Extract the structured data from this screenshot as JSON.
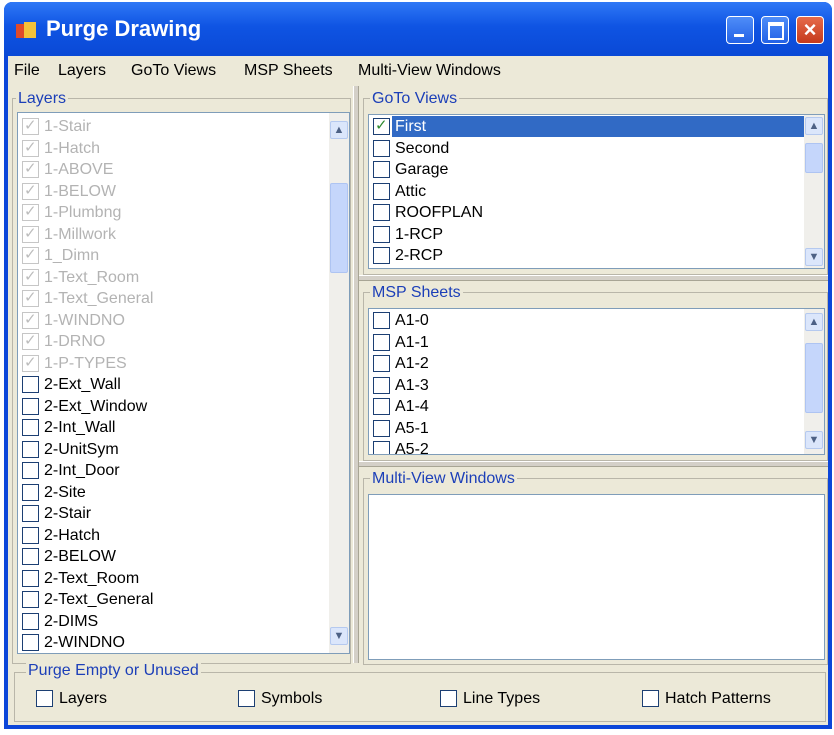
{
  "window": {
    "title": "Purge Drawing"
  },
  "menu": [
    "File",
    "Layers",
    "GoTo Views",
    "MSP Sheets",
    "Multi-View Windows"
  ],
  "layers": {
    "label": "Layers",
    "items": [
      {
        "label": "1-Stair",
        "checked": true,
        "disabled": true
      },
      {
        "label": "1-Hatch",
        "checked": true,
        "disabled": true
      },
      {
        "label": "1-ABOVE",
        "checked": true,
        "disabled": true
      },
      {
        "label": "1-BELOW",
        "checked": true,
        "disabled": true
      },
      {
        "label": "1-Plumbng",
        "checked": true,
        "disabled": true
      },
      {
        "label": "1-Millwork",
        "checked": true,
        "disabled": true
      },
      {
        "label": "1_Dimn",
        "checked": true,
        "disabled": true
      },
      {
        "label": "1-Text_Room",
        "checked": true,
        "disabled": true
      },
      {
        "label": "1-Text_General",
        "checked": true,
        "disabled": true
      },
      {
        "label": "1-WINDNO",
        "checked": true,
        "disabled": true
      },
      {
        "label": "1-DRNO",
        "checked": true,
        "disabled": true
      },
      {
        "label": "1-P-TYPES",
        "checked": true,
        "disabled": true
      },
      {
        "label": "2-Ext_Wall",
        "checked": false,
        "disabled": false
      },
      {
        "label": "2-Ext_Window",
        "checked": false,
        "disabled": false
      },
      {
        "label": "2-Int_Wall",
        "checked": false,
        "disabled": false
      },
      {
        "label": "2-UnitSym",
        "checked": false,
        "disabled": false
      },
      {
        "label": "2-Int_Door",
        "checked": false,
        "disabled": false
      },
      {
        "label": "2-Site",
        "checked": false,
        "disabled": false
      },
      {
        "label": "2-Stair",
        "checked": false,
        "disabled": false
      },
      {
        "label": "2-Hatch",
        "checked": false,
        "disabled": false
      },
      {
        "label": "2-BELOW",
        "checked": false,
        "disabled": false
      },
      {
        "label": "2-Text_Room",
        "checked": false,
        "disabled": false
      },
      {
        "label": "2-Text_General",
        "checked": false,
        "disabled": false
      },
      {
        "label": "2-DIMS",
        "checked": false,
        "disabled": false
      },
      {
        "label": "2-WINDNO",
        "checked": false,
        "disabled": false
      }
    ]
  },
  "goto_views": {
    "label": "GoTo Views",
    "items": [
      {
        "label": "First",
        "checked": true,
        "selected": true
      },
      {
        "label": "Second",
        "checked": false
      },
      {
        "label": "Garage",
        "checked": false
      },
      {
        "label": "Attic",
        "checked": false
      },
      {
        "label": "ROOFPLAN",
        "checked": false
      },
      {
        "label": "1-RCP",
        "checked": false
      },
      {
        "label": "2-RCP",
        "checked": false
      }
    ]
  },
  "msp_sheets": {
    "label": "MSP Sheets",
    "items": [
      {
        "label": "A1-0",
        "checked": false
      },
      {
        "label": "A1-1",
        "checked": false
      },
      {
        "label": "A1-2",
        "checked": false
      },
      {
        "label": "A1-3",
        "checked": false
      },
      {
        "label": "A1-4",
        "checked": false
      },
      {
        "label": "A5-1",
        "checked": false
      },
      {
        "label": "A5-2",
        "checked": false
      }
    ]
  },
  "multi_view_windows": {
    "label": "Multi-View Windows"
  },
  "purge": {
    "label": "Purge Empty or Unused",
    "options": [
      {
        "label": "Layers",
        "checked": false
      },
      {
        "label": "Symbols",
        "checked": false
      },
      {
        "label": "Line Types",
        "checked": false
      },
      {
        "label": "Hatch Patterns",
        "checked": false
      }
    ]
  },
  "colors": {
    "title_bar": "#0f54e3",
    "selection": "#316ac5",
    "group_label": "#1c3fb8",
    "face": "#ece9d8"
  }
}
